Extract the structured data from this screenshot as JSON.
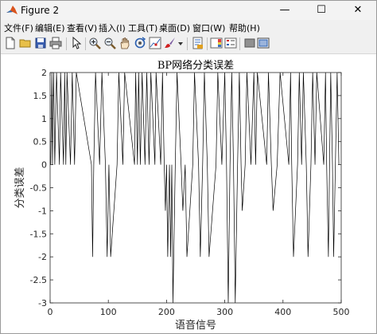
{
  "window": {
    "title": "Figure 2",
    "controls": {
      "minimize": "—",
      "maximize": "☐",
      "close": "✕"
    }
  },
  "menu": [
    {
      "label": "文件(F)"
    },
    {
      "label": "编辑(E)"
    },
    {
      "label": "查看(V)"
    },
    {
      "label": "插入(I)"
    },
    {
      "label": "工具(T)"
    },
    {
      "label": "桌面(D)"
    },
    {
      "label": "窗口(W)"
    },
    {
      "label": "帮助(H)"
    }
  ],
  "toolbar": {
    "icons": [
      "new-figure-icon",
      "open-file-icon",
      "save-icon",
      "print-icon",
      "edit-plot-arrow-icon",
      "zoom-in-icon",
      "zoom-out-icon",
      "pan-hand-icon",
      "rotate-3d-icon",
      "data-cursor-icon",
      "brush-icon",
      "dropdown-arrow-icon",
      "link-plot-icon",
      "insert-colorbar-icon",
      "insert-legend-icon",
      "hide-plot-tools-icon",
      "show-plot-tools-icon"
    ]
  },
  "chart_data": {
    "type": "line",
    "title": "BP网络分类误差",
    "xlabel": "语音信号",
    "ylabel": "分类误差",
    "xlim": [
      0,
      500
    ],
    "ylim": [
      -3,
      2
    ],
    "xticks": [
      0,
      100,
      200,
      300,
      400,
      500
    ],
    "yticks": [
      2,
      1.5,
      1,
      0.5,
      0,
      -0.5,
      -1,
      -1.5,
      -2,
      -2.5,
      -3
    ],
    "ytick_labels": [
      "2",
      "1.5",
      "1",
      "0.5",
      "0",
      "-0.5",
      "-1",
      "-1.5",
      "-2",
      "-2.5",
      "-3"
    ],
    "grid": false,
    "series": [
      {
        "color": "#000000",
        "x": [
          1,
          3,
          4,
          6,
          8,
          11,
          16,
          18,
          23,
          25,
          27,
          29,
          35,
          38,
          42,
          45,
          71,
          73,
          75,
          78,
          85,
          89,
          95,
          98,
          101,
          104,
          115,
          118,
          125,
          128,
          145,
          147,
          150,
          152,
          155,
          158,
          163,
          166,
          170,
          173,
          180,
          182,
          190,
          193,
          196,
          198,
          200,
          202,
          205,
          207,
          209,
          211,
          215,
          218,
          225,
          228,
          232,
          235,
          245,
          248,
          255,
          258,
          262,
          265,
          270,
          273,
          285,
          288,
          295,
          300,
          303,
          306,
          309,
          312,
          315,
          318,
          322,
          325,
          328,
          330,
          335,
          338,
          345,
          350,
          353,
          356,
          372,
          375,
          380,
          383,
          390,
          395,
          410,
          413,
          415,
          418,
          425,
          428,
          432,
          435,
          440,
          443,
          448,
          451,
          455,
          458,
          470,
          473,
          475,
          478,
          480,
          482,
          485,
          487,
          490,
          493,
          496
        ],
        "y": [
          0,
          2,
          0,
          2,
          0,
          2,
          0,
          2,
          0,
          2,
          0,
          2,
          0,
          2,
          0,
          2,
          0,
          -2,
          0,
          2,
          0,
          2,
          0,
          -2,
          0,
          -2,
          0,
          2,
          0,
          2,
          0,
          2,
          0,
          2,
          0,
          2,
          0,
          2,
          0,
          2,
          0,
          2,
          0,
          2,
          0,
          -1,
          0,
          -2,
          0,
          -2,
          0,
          -3,
          0,
          2,
          0,
          -1,
          0,
          -2,
          0,
          2,
          0,
          -2,
          0,
          2,
          0,
          -2,
          0,
          2,
          0,
          2,
          0,
          -3,
          0,
          2,
          0,
          -3,
          0,
          2,
          0,
          -1,
          0,
          2,
          0,
          2,
          0,
          2,
          0,
          2,
          0,
          -1,
          0,
          2,
          0,
          2,
          0,
          -2,
          0,
          2,
          0,
          2,
          0,
          -2,
          0,
          2,
          0,
          2,
          0,
          2,
          0,
          -2,
          0,
          2,
          0,
          -2,
          0,
          2,
          0
        ]
      }
    ]
  }
}
